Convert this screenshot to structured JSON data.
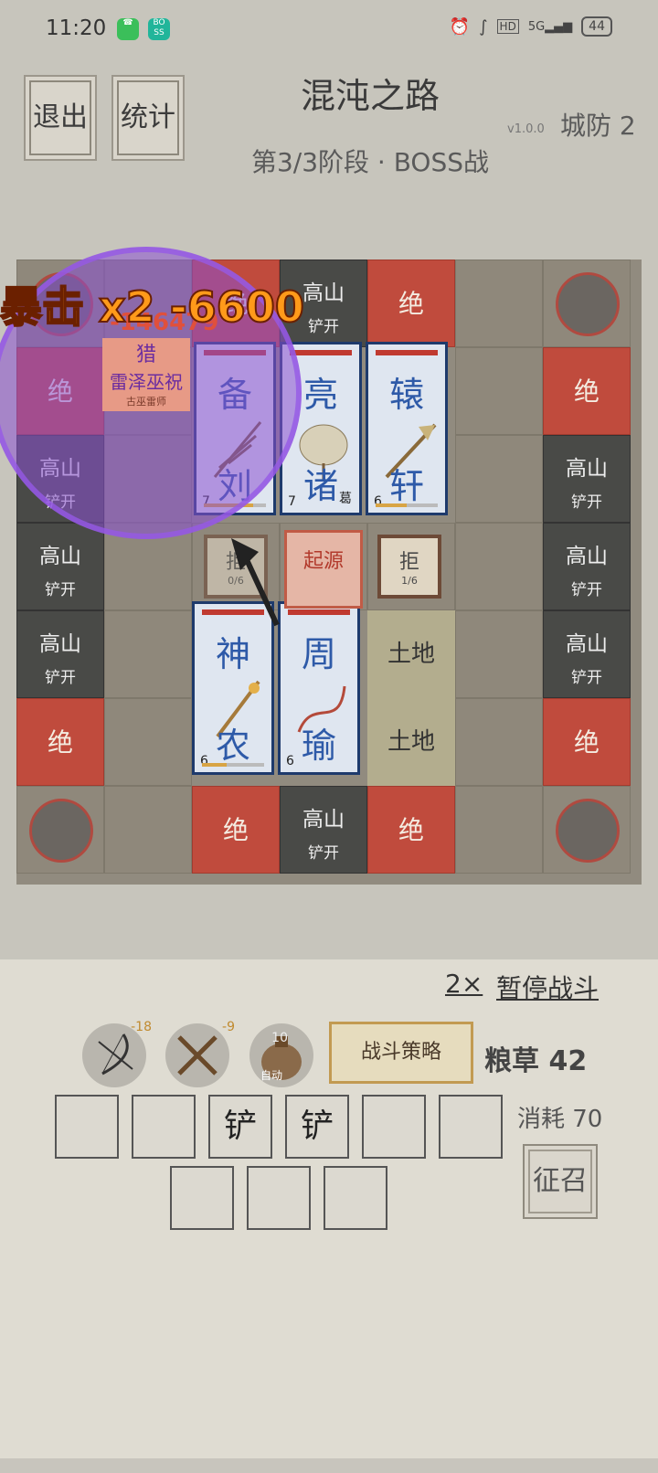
{
  "status_bar": {
    "time": "11:20",
    "badge_boss": "BOSS\n直聘",
    "network": "5G",
    "battery": "44"
  },
  "header": {
    "exit_label": "退出",
    "stats_label": "统计",
    "title": "混沌之路",
    "version": "v1.0.0",
    "city_defense": "城防 2",
    "stage": "第3/3阶段 · BOSS战"
  },
  "board": {
    "tiles": {
      "cliff": "绝",
      "mountain": "高山",
      "dig": "铲开",
      "land": "土地",
      "origin": "起源"
    },
    "heroes": [
      {
        "top": "备",
        "bottom": "刘",
        "level": "7"
      },
      {
        "top": "亮",
        "bottom": "诸",
        "level": "7",
        "tag": "葛"
      },
      {
        "top": "辕",
        "bottom": "轩",
        "level": "6"
      },
      {
        "top": "神",
        "bottom": "农",
        "level": "6"
      },
      {
        "top": "周",
        "bottom": "瑜",
        "level": "6"
      }
    ],
    "blockers": [
      {
        "label": "拒",
        "count": "0/6"
      },
      {
        "label": "拒",
        "count": "1/6"
      }
    ],
    "boss": {
      "name": "雷泽巫祝",
      "subtitle": "古巫雷师",
      "role": "猎"
    },
    "crit_text": "暴击 x2 -6600",
    "damage_text": "-146479"
  },
  "controls": {
    "speed": "2×",
    "pause": "暂停战斗",
    "skills": [
      {
        "icon": "bow-icon",
        "count": "-18"
      },
      {
        "icon": "crossed-tools-icon",
        "count": "-9"
      },
      {
        "icon": "grain-bag-icon",
        "count": "10",
        "sub": "自动"
      }
    ],
    "strategy": "战斗策略",
    "grain": "粮草 42",
    "slots_row1": [
      "",
      "",
      "铲",
      "铲",
      "",
      ""
    ],
    "slots_row2": [
      "",
      "",
      ""
    ],
    "consume": "消耗 70",
    "recruit": "征召"
  }
}
